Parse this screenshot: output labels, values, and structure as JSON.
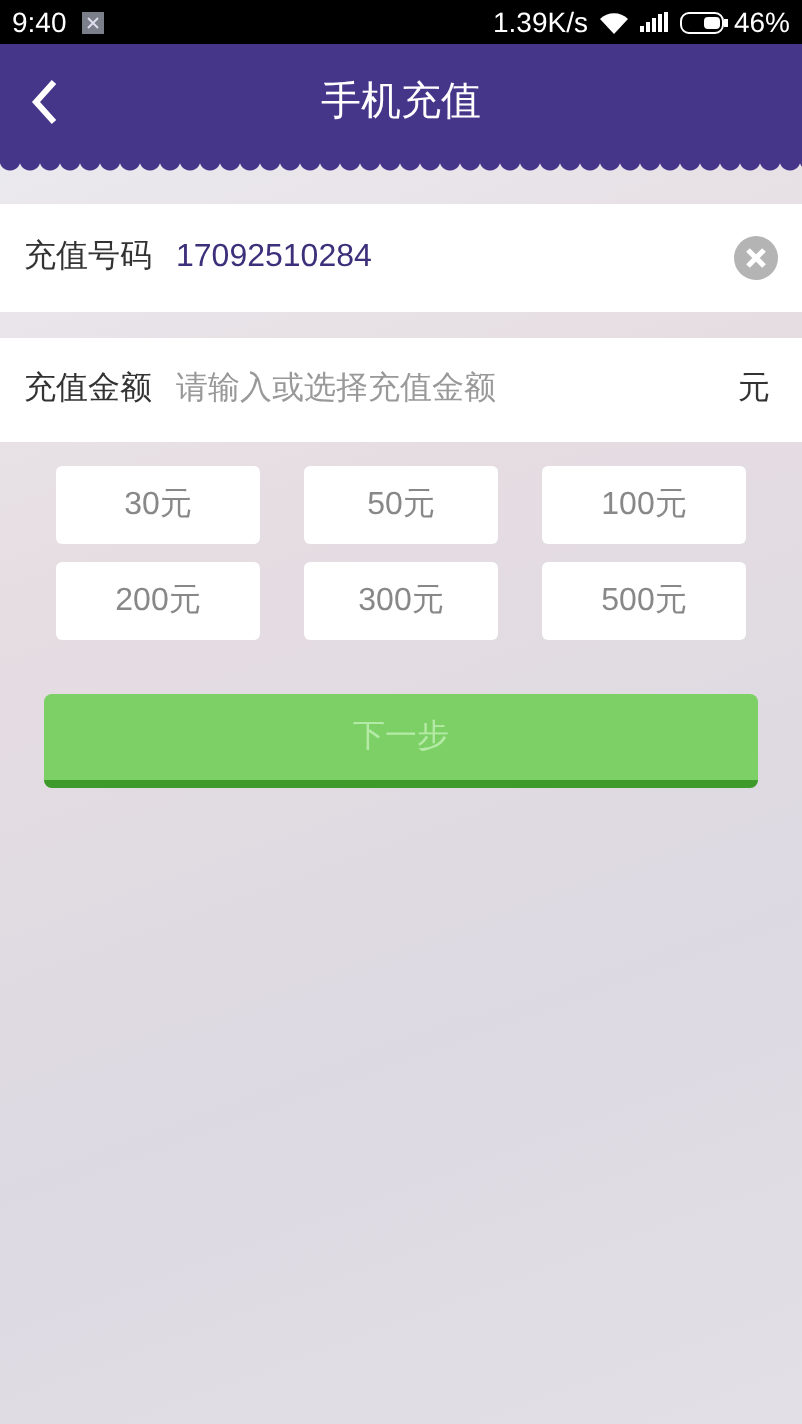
{
  "status_bar": {
    "time": "9:40",
    "speed": "1.39K/s",
    "battery": "46%"
  },
  "header": {
    "title": "手机充值"
  },
  "phone_row": {
    "label": "充值号码",
    "value": "17092510284"
  },
  "amount_row": {
    "label": "充值金额",
    "placeholder": "请输入或选择充值金额",
    "unit": "元"
  },
  "amounts": [
    {
      "label": "30元"
    },
    {
      "label": "50元"
    },
    {
      "label": "100元"
    },
    {
      "label": "200元"
    },
    {
      "label": "300元"
    },
    {
      "label": "500元"
    }
  ],
  "next_button": {
    "label": "下一步",
    "disabled": true
  }
}
